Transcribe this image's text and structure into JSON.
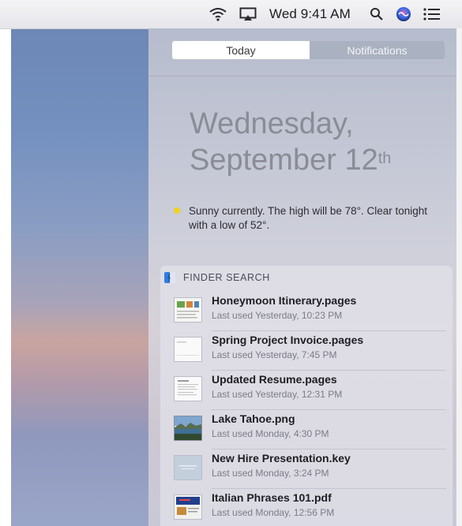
{
  "menubar": {
    "clock": "Wed 9:41 AM",
    "icons": [
      "wifi-icon",
      "airplay-icon",
      "spotlight-icon",
      "siri-icon",
      "notification-center-icon"
    ]
  },
  "tabs": {
    "today": "Today",
    "notifications": "Notifications"
  },
  "date": {
    "weekday": "Wednesday,",
    "month_day": "September 12",
    "ordinal": "th"
  },
  "weather": {
    "text": "Sunny currently. The high will be 78°. Clear tonight with a low of 52°.",
    "icon": "sun-icon",
    "icon_color": "#f1d21c"
  },
  "finder_search": {
    "title": "FINDER SEARCH",
    "items": [
      {
        "name": "Honeymoon Itinerary.pages",
        "meta": "Last used Yesterday, 10:23 PM"
      },
      {
        "name": "Spring Project Invoice.pages",
        "meta": "Last used Yesterday, 7:45 PM"
      },
      {
        "name": "Updated Resume.pages",
        "meta": "Last used Yesterday, 12:31 PM"
      },
      {
        "name": "Lake Tahoe.png",
        "meta": "Last used Monday, 4:30 PM"
      },
      {
        "name": "New Hire Presentation.key",
        "meta": "Last used Monday, 3:24 PM"
      },
      {
        "name": "Italian Phrases 101.pdf",
        "meta": "Last used Monday, 12:56 PM"
      }
    ]
  },
  "colors": {
    "segment_active": "#ffffff",
    "segment_inactive": "#aab1c0",
    "accent_siri": "#3a6ff0"
  }
}
